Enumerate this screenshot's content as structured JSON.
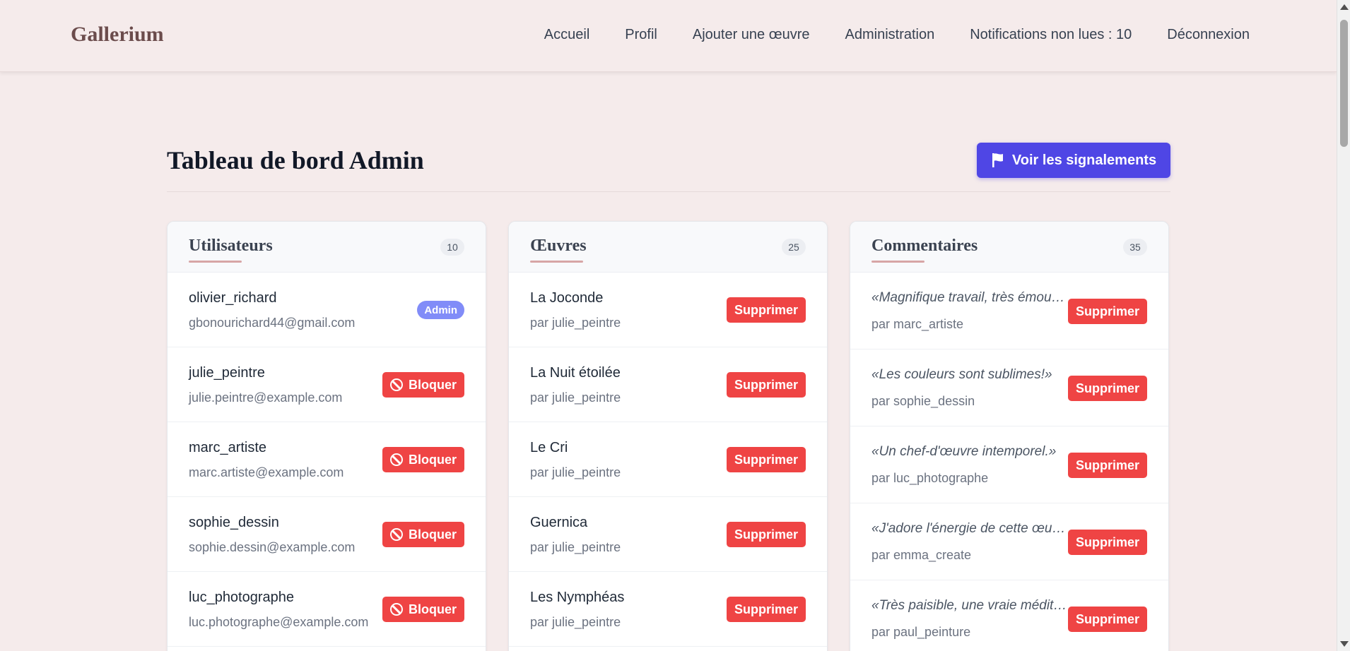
{
  "nav": {
    "brand": "Gallerium",
    "links": [
      "Accueil",
      "Profil",
      "Ajouter une œuvre",
      "Administration",
      "Notifications non lues : 10",
      "Déconnexion"
    ]
  },
  "page": {
    "title": "Tableau de bord Admin",
    "reports_button": "Voir les signalements"
  },
  "users": {
    "title": "Utilisateurs",
    "count": "10",
    "items": [
      {
        "name": "olivier_richard",
        "email": "gbonourichard44@gmail.com",
        "badge": "Admin"
      },
      {
        "name": "julie_peintre",
        "email": "julie.peintre@example.com",
        "action": "Bloquer"
      },
      {
        "name": "marc_artiste",
        "email": "marc.artiste@example.com",
        "action": "Bloquer"
      },
      {
        "name": "sophie_dessin",
        "email": "sophie.dessin@example.com",
        "action": "Bloquer"
      },
      {
        "name": "luc_photographe",
        "email": "luc.photographe@example.com",
        "action": "Bloquer"
      }
    ]
  },
  "works": {
    "title": "Œuvres",
    "count": "25",
    "items": [
      {
        "title": "La Joconde",
        "author": "par julie_peintre",
        "action": "Supprimer"
      },
      {
        "title": "La Nuit étoilée",
        "author": "par julie_peintre",
        "action": "Supprimer"
      },
      {
        "title": "Le Cri",
        "author": "par julie_peintre",
        "action": "Supprimer"
      },
      {
        "title": "Guernica",
        "author": "par julie_peintre",
        "action": "Supprimer"
      },
      {
        "title": "Les Nymphéas",
        "author": "par julie_peintre",
        "action": "Supprimer"
      }
    ]
  },
  "comments": {
    "title": "Commentaires",
    "count": "35",
    "items": [
      {
        "text": "«Magnifique travail, très émouva...",
        "author": "par marc_artiste",
        "action": "Supprimer"
      },
      {
        "text": "«Les couleurs sont sublimes!»",
        "author": "par sophie_dessin",
        "action": "Supprimer"
      },
      {
        "text": "«Un chef-d'œuvre intemporel.»",
        "author": "par luc_photographe",
        "action": "Supprimer"
      },
      {
        "text": "«J'adore l'énergie de cette œuvre!»",
        "author": "par emma_create",
        "action": "Supprimer"
      },
      {
        "text": "«Très paisible, une vraie méditati...",
        "author": "par paul_peinture",
        "action": "Supprimer"
      }
    ]
  },
  "colors": {
    "background": "#f5ebeb",
    "brand": "#6b4c4c",
    "primary": "#4f46e5",
    "danger": "#ef4444",
    "admin_badge": "#818cf8"
  },
  "icons": {
    "reports": "flag-icon",
    "block": "ban-icon"
  }
}
